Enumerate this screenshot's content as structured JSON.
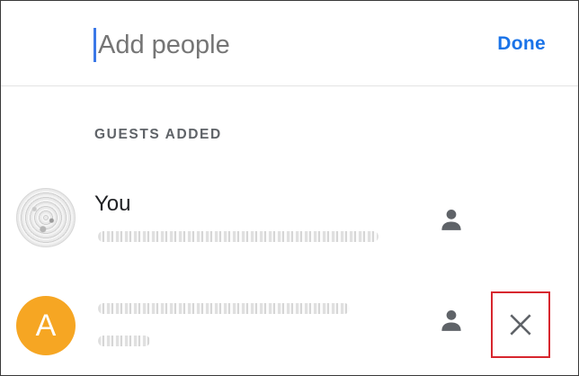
{
  "header": {
    "add_placeholder": "Add people",
    "done_label": "Done"
  },
  "section": {
    "label": "GUESTS ADDED"
  },
  "guests": [
    {
      "name": "You",
      "avatar": "photo",
      "role_icon": "person-icon"
    },
    {
      "name": "",
      "avatar_letter": "A",
      "avatar_color": "#f6a623",
      "role_icon": "person-icon",
      "action_icon": "close-icon"
    }
  ],
  "colors": {
    "accent": "#1a73e8",
    "caret": "#3b78e7",
    "highlight_border": "#d7262e",
    "icon_gray": "#5f6368"
  }
}
